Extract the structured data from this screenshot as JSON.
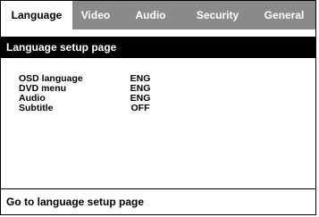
{
  "tabs": [
    {
      "label": "Language",
      "active": true
    },
    {
      "label": "Video",
      "active": false
    },
    {
      "label": "Audio",
      "active": false
    },
    {
      "label": "Security",
      "active": false
    },
    {
      "label": "General",
      "active": false
    }
  ],
  "header": {
    "title": "Language setup page"
  },
  "settings": [
    {
      "label": "OSD language",
      "value": "ENG"
    },
    {
      "label": "DVD menu",
      "value": "ENG"
    },
    {
      "label": "Audio",
      "value": "ENG"
    },
    {
      "label": "Subtitle",
      "value": "OFF"
    }
  ],
  "footer": {
    "help_text": "Go to language setup page"
  },
  "colors": {
    "tab_bar": "#8a8a8a",
    "active_tab": "#ffffff",
    "header_bg": "#000000",
    "text": "#000000"
  }
}
